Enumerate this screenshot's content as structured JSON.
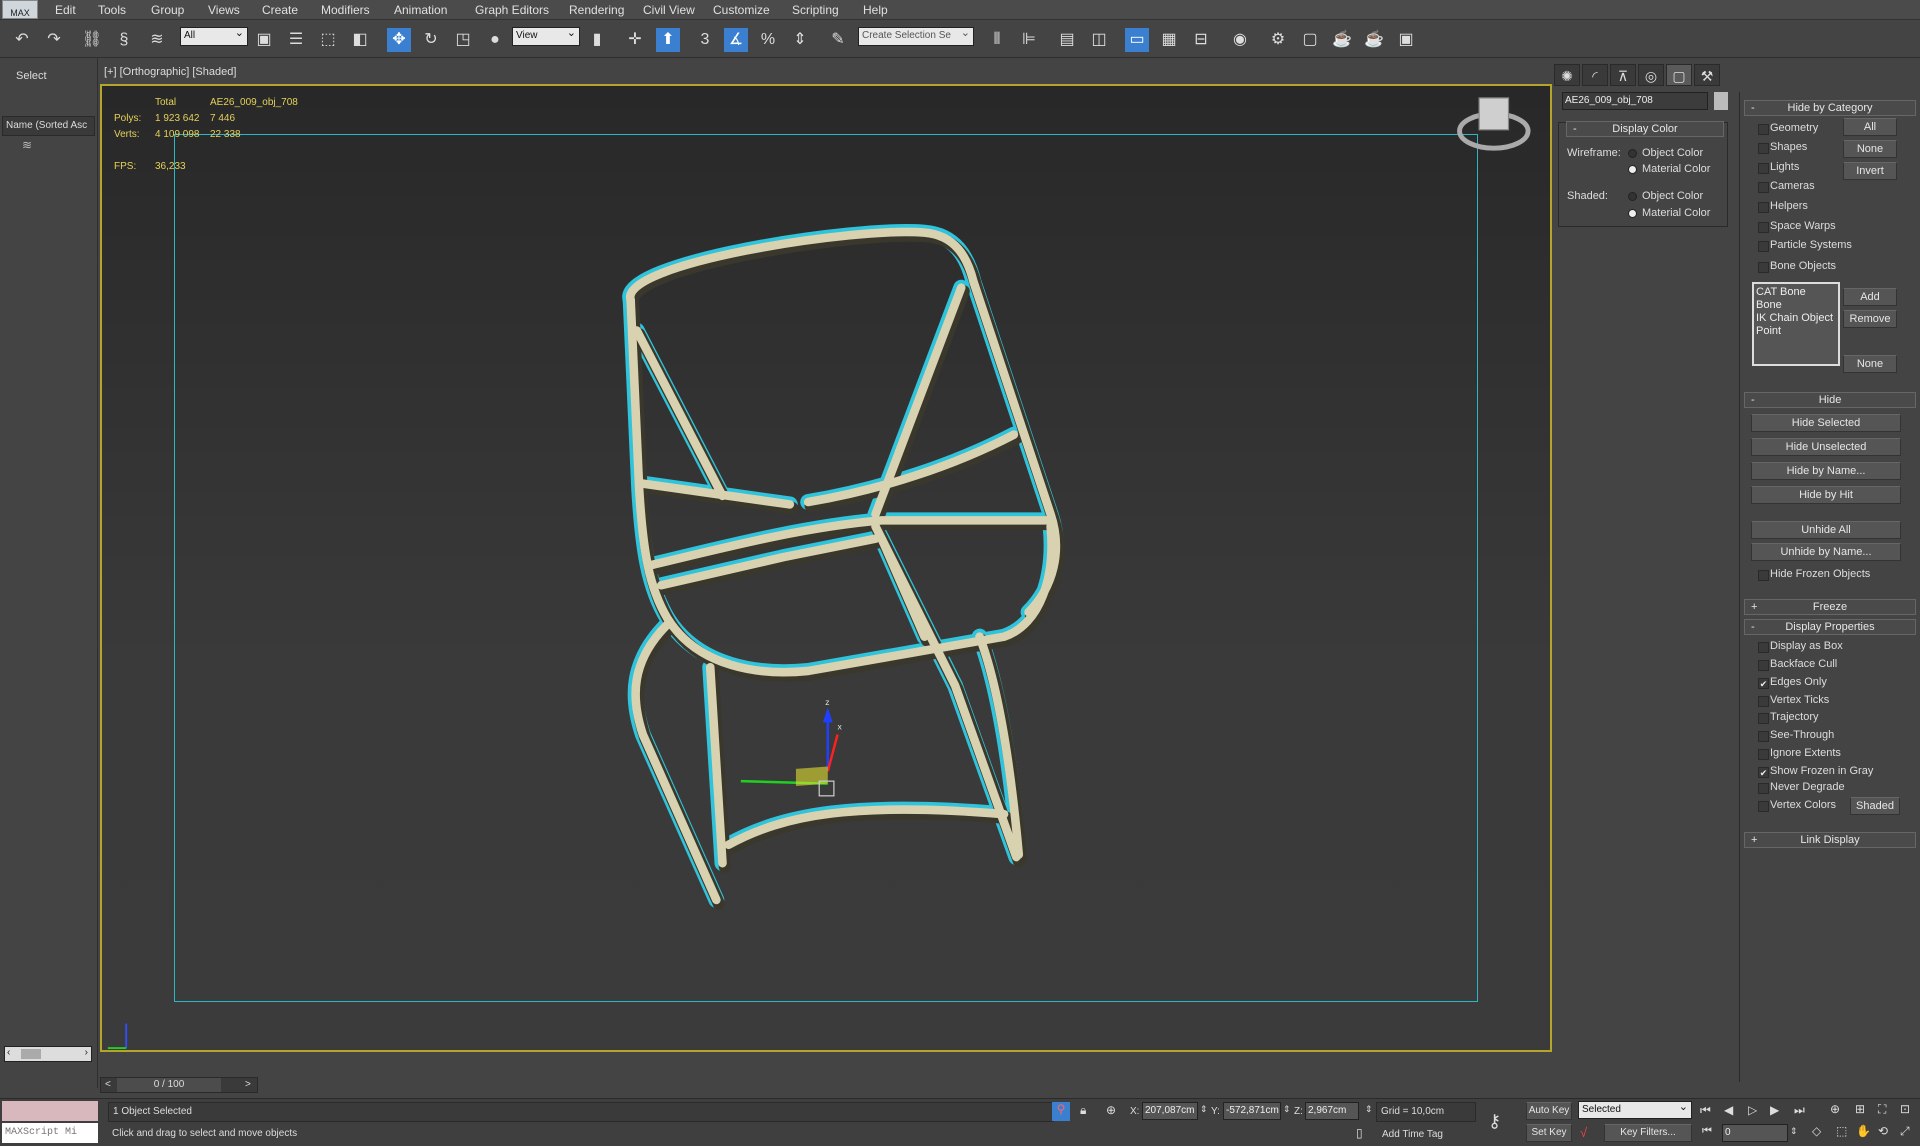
{
  "app": {
    "logo": "MAX"
  },
  "menu": [
    "Edit",
    "Tools",
    "Group",
    "Views",
    "Create",
    "Modifiers",
    "Animation",
    "Graph Editors",
    "Rendering",
    "Civil View",
    "Customize",
    "Scripting",
    "Help"
  ],
  "toolbar": {
    "selection_filter": "All",
    "ref_coord": "View",
    "named_selection_placeholder": "Create Selection Se",
    "snap_label": "3"
  },
  "left_panel": {
    "select_label": "Select",
    "column_header": "Name (Sorted Asc"
  },
  "viewport": {
    "label": "[+] [Orthographic] [Shaded]",
    "stats": {
      "col_total": "Total",
      "col_obj": "AE26_009_obj_708",
      "polys_label": "Polys:",
      "polys_total": "1 923 642",
      "polys_obj": "7 446",
      "verts_label": "Verts:",
      "verts_total": "4 109 098",
      "verts_obj": "22 338",
      "fps_label": "FPS:",
      "fps": "36,233"
    },
    "colors": {
      "border": "#b5a52a",
      "safe_frame": "#2bb8c4",
      "tube": "#d8d2b0",
      "selection": "#2fc3dc"
    }
  },
  "command_panel": {
    "object_name": "AE26_009_obj_708",
    "display_color": {
      "title": "Display Color",
      "wireframe_label": "Wireframe:",
      "shaded_label": "Shaded:",
      "opt_object": "Object Color",
      "opt_material": "Material Color",
      "wireframe_selected": "Material Color",
      "shaded_selected": "Material Color"
    },
    "hide_by_category": {
      "title": "Hide by Category",
      "items": [
        {
          "label": "Geometry",
          "checked": false
        },
        {
          "label": "Shapes",
          "checked": false
        },
        {
          "label": "Lights",
          "checked": false
        },
        {
          "label": "Cameras",
          "checked": false
        },
        {
          "label": "Helpers",
          "checked": false
        },
        {
          "label": "Space Warps",
          "checked": false
        },
        {
          "label": "Particle Systems",
          "checked": false
        },
        {
          "label": "Bone Objects",
          "checked": false
        }
      ],
      "btn_all": "All",
      "btn_none": "None",
      "btn_invert": "Invert",
      "list": [
        "CAT Bone",
        "Bone",
        "IK Chain Object",
        "Point"
      ],
      "btn_add": "Add",
      "btn_remove": "Remove",
      "btn_list_none": "None"
    },
    "hide": {
      "title": "Hide",
      "buttons": [
        "Hide Selected",
        "Hide Unselected",
        "Hide by Name...",
        "Hide by Hit",
        "Unhide All",
        "Unhide by Name..."
      ],
      "frozen_label": "Hide Frozen Objects",
      "frozen_checked": false
    },
    "freeze": {
      "title": "Freeze"
    },
    "display_properties": {
      "title": "Display Properties",
      "items": [
        {
          "label": "Display as Box",
          "checked": false
        },
        {
          "label": "Backface Cull",
          "checked": false
        },
        {
          "label": "Edges Only",
          "checked": true
        },
        {
          "label": "Vertex Ticks",
          "checked": false
        },
        {
          "label": "Trajectory",
          "checked": false
        },
        {
          "label": "See-Through",
          "checked": false
        },
        {
          "label": "Ignore Extents",
          "checked": false
        },
        {
          "label": "Show Frozen in Gray",
          "checked": true
        },
        {
          "label": "Never Degrade",
          "checked": false
        },
        {
          "label": "Vertex Colors",
          "checked": false
        }
      ],
      "shaded_btn": "Shaded"
    },
    "link_display": {
      "title": "Link Display"
    }
  },
  "timeline": {
    "frame": "0 / 100",
    "prev": "<",
    "next": ">"
  },
  "status": {
    "maxscript": "MAXScript Mi",
    "selection": "1 Object Selected",
    "prompt": "Click and drag to select and move objects",
    "x_label": "X:",
    "x": "207,087cm",
    "y_label": "Y:",
    "y": "-572,871cm",
    "z_label": "Z:",
    "z": "2,967cm",
    "grid": "Grid = 10,0cm",
    "add_time_tag": "Add Time Tag",
    "auto_key": "Auto Key",
    "set_key": "Set Key",
    "key_mode": "Selected",
    "key_filters": "Key Filters...",
    "current_frame": "0"
  }
}
